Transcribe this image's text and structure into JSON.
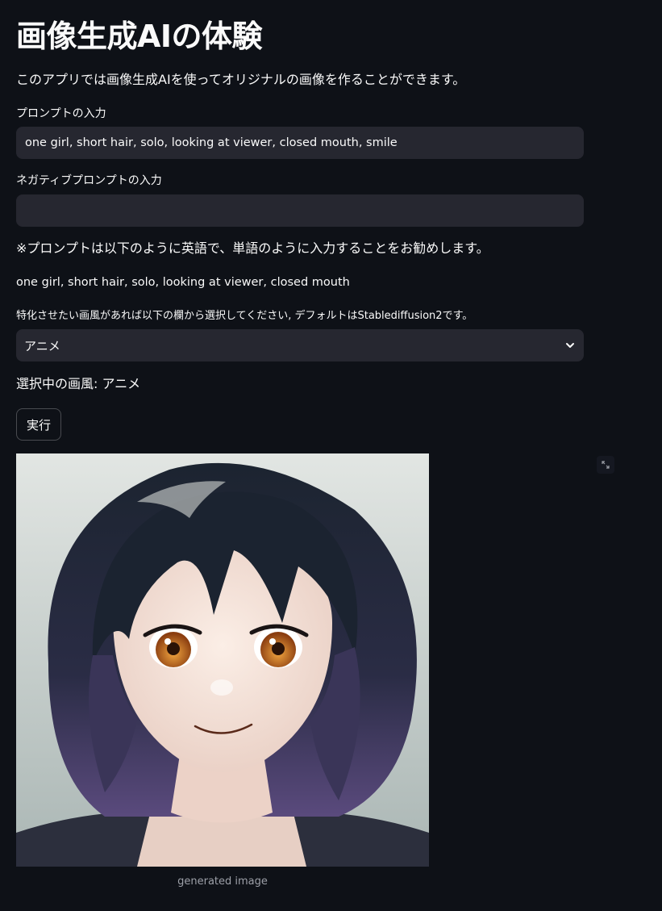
{
  "header": {
    "title": "画像生成AIの体験",
    "intro": "このアプリでは画像生成AIを使ってオリジナルの画像を作ることができます。"
  },
  "prompt": {
    "label": "プロンプトの入力",
    "value": "one girl, short hair, solo, looking at viewer, closed mouth, smile"
  },
  "negative_prompt": {
    "label": "ネガティブプロンプトの入力",
    "value": ""
  },
  "guidance": {
    "note": "※プロンプトは以下のように英語で、単語のように入力することをお勧めします。",
    "example": "one girl, short hair, solo, looking at viewer, closed mouth"
  },
  "style_select": {
    "label": "特化させたい画風があれば以下の欄から選択してください, デフォルトはStablediffusion2です。",
    "selected": "アニメ",
    "icon": "chevron-down-icon"
  },
  "selected_style_line": "選択中の画風: アニメ",
  "run_button": {
    "label": "実行"
  },
  "output": {
    "caption": "generated image",
    "fullscreen_icon": "expand-icon"
  },
  "colors": {
    "background": "#0e1117",
    "input_background": "#262730",
    "text": "#fafafa",
    "caption": "#9da0a8"
  }
}
